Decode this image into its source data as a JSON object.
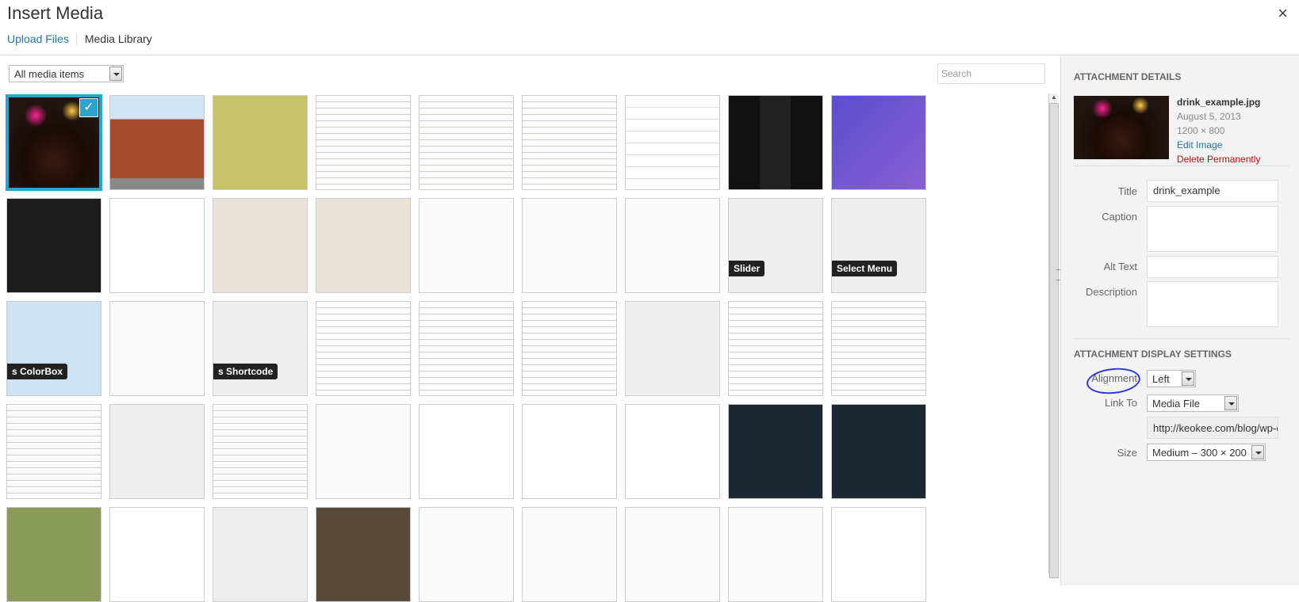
{
  "header": {
    "title": "Insert Media",
    "close_icon": "×",
    "tabs": [
      "Upload Files",
      "Media Library"
    ]
  },
  "toolbar": {
    "filter_value": "All media items",
    "search_placeholder": "Search"
  },
  "grid": {
    "selected_index": 0,
    "check_icon": "✓",
    "tiles": [
      {
        "style": "drink",
        "label": ""
      },
      {
        "style": "brick",
        "label": ""
      },
      {
        "style": "green",
        "label": ""
      },
      {
        "style": "doc",
        "label": ""
      },
      {
        "style": "doc",
        "label": ""
      },
      {
        "style": "doc",
        "label": ""
      },
      {
        "style": "form",
        "label": ""
      },
      {
        "style": "phone",
        "label": ""
      },
      {
        "style": "purple",
        "label": ""
      },
      {
        "style": "bars",
        "label": ""
      },
      {
        "style": "line",
        "label": ""
      },
      {
        "style": "map",
        "label": ""
      },
      {
        "style": "map",
        "label": ""
      },
      {
        "style": "web",
        "label": ""
      },
      {
        "style": "web",
        "label": ""
      },
      {
        "style": "web",
        "label": ""
      },
      {
        "style": "gray",
        "label": "Slider"
      },
      {
        "style": "gray",
        "label": "Select Menu"
      },
      {
        "style": "blue",
        "label": "s ColorBox"
      },
      {
        "style": "web",
        "label": ""
      },
      {
        "style": "gray",
        "label": "s Shortcode"
      },
      {
        "style": "doc",
        "label": ""
      },
      {
        "style": "doc",
        "label": ""
      },
      {
        "style": "doc",
        "label": ""
      },
      {
        "style": "gray",
        "label": ""
      },
      {
        "style": "doc",
        "label": ""
      },
      {
        "style": "doc",
        "label": ""
      },
      {
        "style": "doc",
        "label": ""
      },
      {
        "style": "gray",
        "label": ""
      },
      {
        "style": "doc",
        "label": ""
      },
      {
        "style": "web",
        "label": ""
      },
      {
        "style": "qr",
        "label": ""
      },
      {
        "style": "qr",
        "label": ""
      },
      {
        "style": "signs",
        "label": ""
      },
      {
        "style": "social",
        "label": ""
      },
      {
        "style": "social",
        "label": ""
      },
      {
        "style": "girl",
        "label": ""
      },
      {
        "style": "wp",
        "label": ""
      },
      {
        "style": "keo",
        "label": ""
      },
      {
        "style": "wolf",
        "label": ""
      },
      {
        "style": "web",
        "label": ""
      },
      {
        "style": "web",
        "label": ""
      },
      {
        "style": "web",
        "label": ""
      },
      {
        "style": "web",
        "label": ""
      },
      {
        "style": "sand",
        "label": ""
      }
    ]
  },
  "details": {
    "heading": "ATTACHMENT DETAILS",
    "filename": "drink_example.jpg",
    "date": "August 5, 2013",
    "dimensions": "1200 × 800",
    "edit_link": "Edit Image",
    "delete_link": "Delete Permanently",
    "title_label": "Title",
    "title_value": "drink_example",
    "caption_label": "Caption",
    "alt_label": "Alt Text",
    "description_label": "Description"
  },
  "display": {
    "heading": "ATTACHMENT DISPLAY SETTINGS",
    "alignment_label": "Alignment",
    "alignment_value": "Left",
    "link_label": "Link To",
    "link_value": "Media File",
    "url_value": "http://keokee.com/blog/wp-co",
    "size_label": "Size",
    "size_value": "Medium – 300 × 200"
  },
  "colors": {
    "accent": "#2ea2cc",
    "link": "#21759b",
    "delete": "#bc0b0b"
  }
}
